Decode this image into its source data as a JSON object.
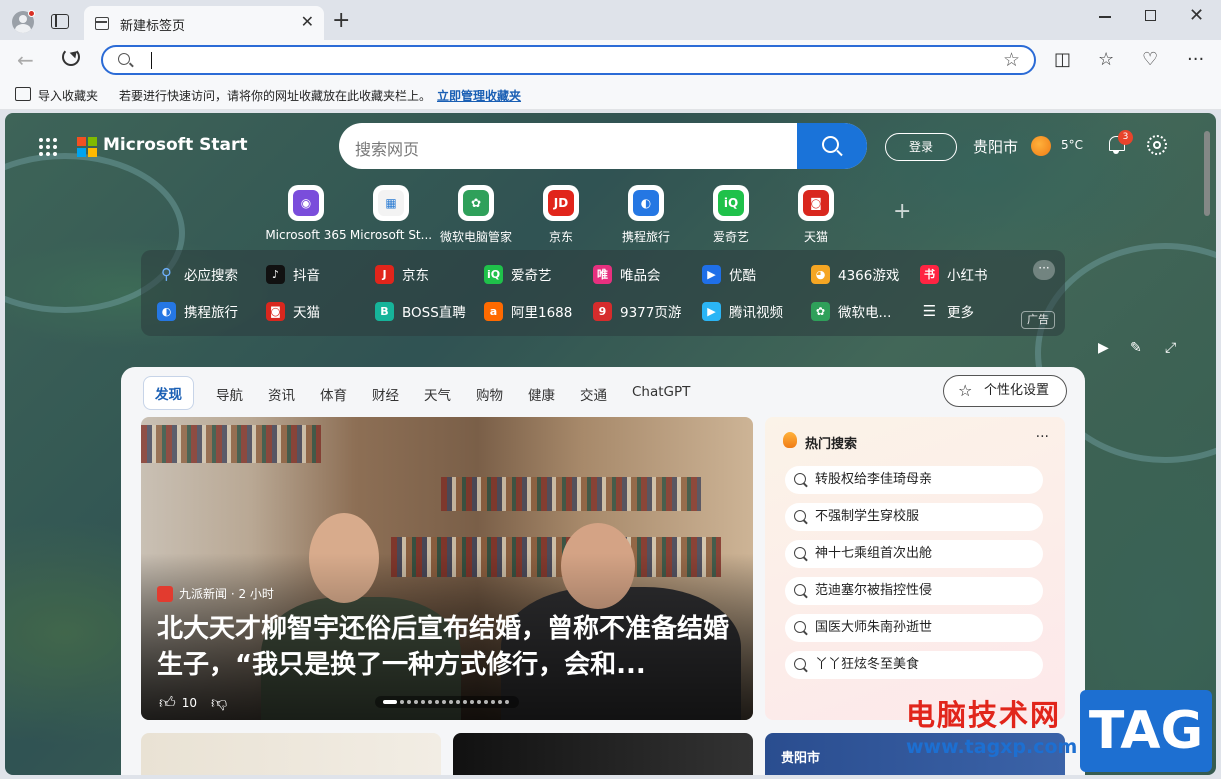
{
  "browser": {
    "tab_title": "新建标签页",
    "tab_close": "✕",
    "new_tab": "+",
    "address_value": "",
    "window_controls": {
      "minimize": "—",
      "maximize": "☐",
      "close": "✕"
    },
    "toolbar_icons": [
      "split-screen-icon",
      "favorites-icon",
      "browser-essentials-icon",
      "more-icon"
    ]
  },
  "favorites_bar": {
    "import_label": "导入收藏夹",
    "hint": "若要进行快速访问，请将你的网址收藏放在此收藏夹栏上。",
    "manage_link": "立即管理收藏夹"
  },
  "header": {
    "brand": "Microsoft Start",
    "search_placeholder": "搜索网页",
    "login": "登录",
    "city": "贵阳市",
    "temperature": "5°C",
    "notification_count": "3"
  },
  "quick_apps": [
    {
      "label": "Microsoft 365",
      "color": "#7a4ddb",
      "glyph": "◉"
    },
    {
      "label": "Microsoft St...",
      "color": "#f3f3f3",
      "glyph": "▦"
    },
    {
      "label": "微软电脑管家",
      "color": "#2fa05a",
      "glyph": "✿"
    },
    {
      "label": "京东",
      "color": "#e1251b",
      "glyph": "JD"
    },
    {
      "label": "携程旅行",
      "color": "#2577e3",
      "glyph": "◐"
    },
    {
      "label": "爱奇艺",
      "color": "#1fc14a",
      "glyph": "iQ"
    },
    {
      "label": "天猫",
      "color": "#d9271e",
      "glyph": "◙"
    }
  ],
  "links": {
    "row1": [
      {
        "label": "必应搜索",
        "color": "transparent",
        "glyph": "⚲"
      },
      {
        "label": "抖音",
        "color": "#111111",
        "glyph": "♪"
      },
      {
        "label": "京东",
        "color": "#e1251b",
        "glyph": "J"
      },
      {
        "label": "爱奇艺",
        "color": "#1fc14a",
        "glyph": "iQ"
      },
      {
        "label": "唯品会",
        "color": "#e7307f",
        "glyph": "唯"
      },
      {
        "label": "优酷",
        "color": "#1f6fe8",
        "glyph": "▶"
      },
      {
        "label": "4366游戏",
        "color": "#f5a623",
        "glyph": "◕"
      },
      {
        "label": "小红书",
        "color": "#ff2442",
        "glyph": "书"
      }
    ],
    "row2": [
      {
        "label": "携程旅行",
        "color": "#2577e3",
        "glyph": "◐"
      },
      {
        "label": "天猫",
        "color": "#d9271e",
        "glyph": "◙"
      },
      {
        "label": "BOSS直聘",
        "color": "#16b49a",
        "glyph": "B"
      },
      {
        "label": "阿里1688",
        "color": "#ff6a00",
        "glyph": "a"
      },
      {
        "label": "9377页游",
        "color": "#d62c2c",
        "glyph": "9"
      },
      {
        "label": "腾讯视频",
        "color": "#2bb5f5",
        "glyph": "▶"
      },
      {
        "label": "微软电...",
        "color": "#2fa05a",
        "glyph": "✿"
      },
      {
        "label": "更多",
        "color": "transparent",
        "glyph": "☰"
      }
    ],
    "more": "···",
    "ad": "广告"
  },
  "feed": {
    "tabs": [
      "发现",
      "导航",
      "资讯",
      "体育",
      "财经",
      "天气",
      "购物",
      "健康",
      "交通",
      "ChatGPT"
    ],
    "personalize": "个性化设置",
    "hero": {
      "source": "九派新闻 · 2 小时",
      "title": "北大天才柳智宇还俗后宣布结婚，曾称不准备结婚生子，“我只是换了一种方式修行，会和...",
      "likes": "10"
    },
    "hot": {
      "title": "热门搜索",
      "more": "···",
      "items": [
        "转股权给李佳琦母亲",
        "不强制学生穿校服",
        "神十七乘组首次出舱",
        "范迪塞尔被指控性侵",
        "国医大师朱南孙逝世",
        "丫丫狂炫冬至美食"
      ]
    },
    "weather_city": "贵阳市"
  },
  "watermark": {
    "text": "电脑技术网",
    "url": "www.tagxp.com",
    "tag": "TAG"
  }
}
